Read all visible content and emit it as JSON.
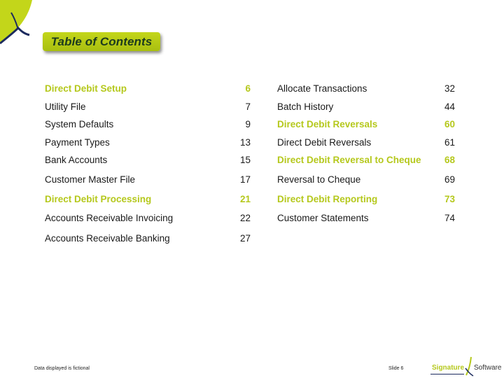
{
  "header": {
    "title": "Table of Contents"
  },
  "toc": {
    "left": [
      {
        "label": "Direct Debit Setup",
        "page": "6",
        "highlight": true
      },
      {
        "label": "Utility File",
        "page": "7",
        "highlight": false
      },
      {
        "label": "System Defaults",
        "page": "9",
        "highlight": false
      },
      {
        "label": "Payment Types",
        "page": "13",
        "highlight": false
      },
      {
        "label": "Bank Accounts",
        "page": "15",
        "highlight": false
      },
      {
        "label": "Customer Master File",
        "page": "17",
        "highlight": false
      },
      {
        "label": "Direct Debit Processing",
        "page": "21",
        "highlight": true
      },
      {
        "label": "Accounts Receivable Invoicing",
        "page": "22",
        "highlight": false
      },
      {
        "label": "Accounts Receivable Banking",
        "page": "27",
        "highlight": false
      }
    ],
    "right": [
      {
        "label": "Allocate Transactions",
        "page": "32",
        "highlight": false
      },
      {
        "label": "Batch History",
        "page": "44",
        "highlight": false
      },
      {
        "label": "Direct Debit Reversals",
        "page": "60",
        "highlight": true
      },
      {
        "label": "Direct Debit Reversals",
        "page": "61",
        "highlight": false
      },
      {
        "label": "Direct Debit Reversal to Cheque",
        "page": "68",
        "highlight": true
      },
      {
        "label": "Reversal to Cheque",
        "page": "69",
        "highlight": false
      },
      {
        "label": "Direct Debit Reporting",
        "page": "73",
        "highlight": true
      },
      {
        "label": "Customer Statements",
        "page": "74",
        "highlight": false
      }
    ]
  },
  "footer": {
    "note": "Data displayed is fictional",
    "slide": "Slide 6",
    "brand_left": "Signature",
    "brand_right": "Software"
  },
  "colors": {
    "accent": "#b5c81c",
    "badge": "#b8cc14",
    "navy": "#1c2b5e",
    "text": "#1a1a1a"
  },
  "icons": {
    "corner_logo": "signature-x-logo-icon",
    "brand_logo": "signature-software-logo-icon"
  }
}
